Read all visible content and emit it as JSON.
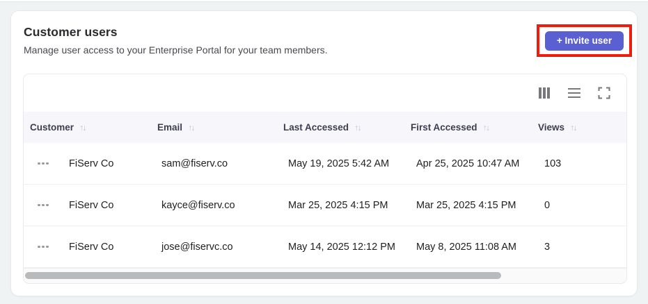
{
  "header": {
    "title": "Customer users",
    "subtitle": "Manage user access to your Enterprise Portal for your team members.",
    "invite_button_label": "+ Invite user"
  },
  "colors": {
    "accent": "#5a5fd2",
    "annotation_highlight": "#ee1d0e",
    "page_background": "#eff3f4",
    "header_row_background": "#f7f7fb"
  },
  "toolbar": {
    "icons": [
      "columns-icon",
      "density-icon",
      "fullscreen-icon"
    ]
  },
  "table": {
    "columns": [
      {
        "label": "Customer",
        "sortable": true
      },
      {
        "label": "Email",
        "sortable": true
      },
      {
        "label": "Last Accessed",
        "sortable": true
      },
      {
        "label": "First Accessed",
        "sortable": true
      },
      {
        "label": "Views",
        "sortable": true
      }
    ],
    "rows": [
      {
        "customer": "FiServ Co",
        "email": "sam@fiserv.co",
        "last_accessed": "May 19, 2025 5:42 AM",
        "first_accessed": "Apr 25, 2025 10:47 AM",
        "views": "103"
      },
      {
        "customer": "FiServ Co",
        "email": "kayce@fiserv.co",
        "last_accessed": "Mar 25, 2025 4:15 PM",
        "first_accessed": "Mar 25, 2025 4:15 PM",
        "views": "0"
      },
      {
        "customer": "FiServ Co",
        "email": "jose@fiservc.co",
        "last_accessed": "May 14, 2025 12:12 PM",
        "first_accessed": "May 8, 2025 11:08 AM",
        "views": "3"
      }
    ]
  },
  "scrollbar": {
    "thumb_percent": 79
  }
}
